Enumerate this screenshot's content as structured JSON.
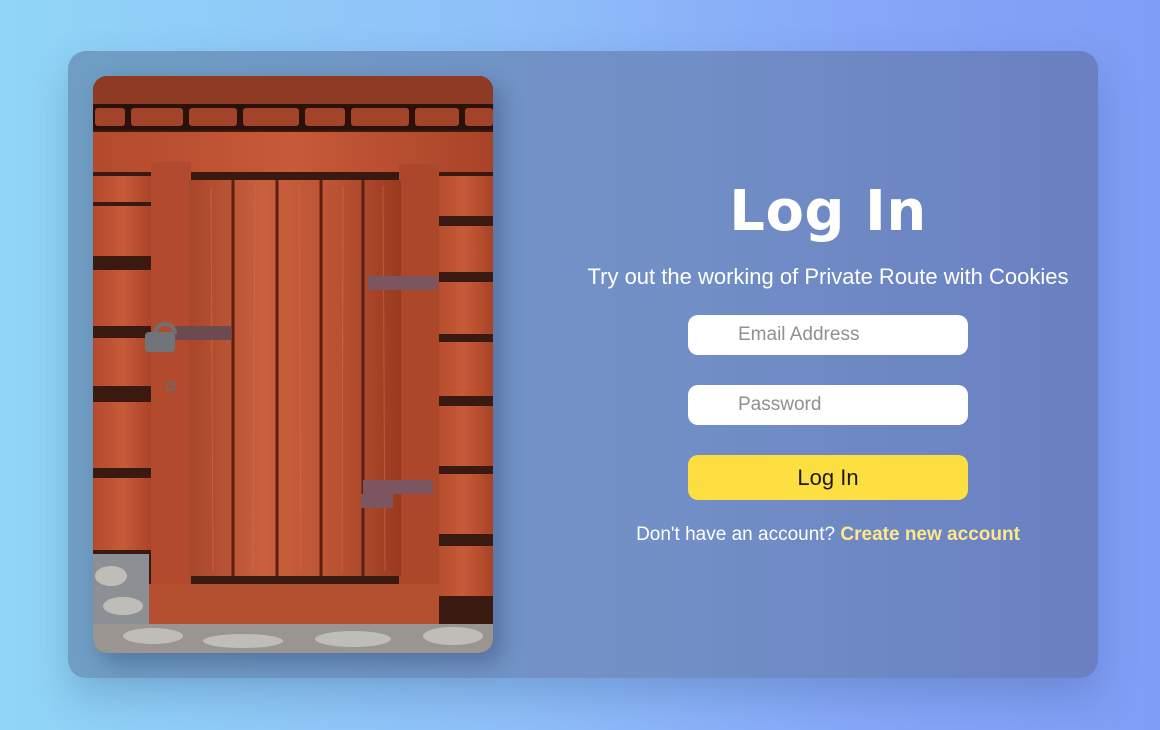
{
  "login": {
    "title": "Log In",
    "subtitle": "Try out the working of Private Route with Cookies",
    "email_placeholder": "Email Address",
    "password_placeholder": "Password",
    "submit_label": "Log In",
    "signup_prompt": "Don't have an account?",
    "signup_link": "Create new account"
  },
  "colors": {
    "background_left": "#90d6f7",
    "background_right": "#7f9df5",
    "card": "#7290c6",
    "button": "#fddf42",
    "link": "#ffe88a",
    "text": "#ffffff"
  },
  "image": {
    "subject": "weathered red wooden barn door with padlock and hinges"
  }
}
